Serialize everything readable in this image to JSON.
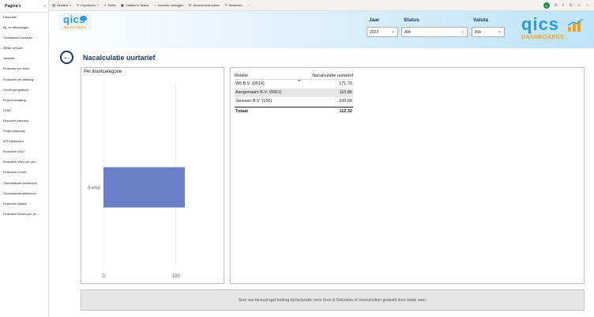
{
  "sidebar": {
    "title": "Pagina's",
    "collapse_icon": "«",
    "items": [
      {
        "label": "Facturatie"
      },
      {
        "label": "Bij- en afboekingen"
      },
      {
        "label": "Gerealiseerd uurtarief"
      },
      {
        "label": "Ziekte verzuim"
      },
      {
        "label": "Vakantie"
      },
      {
        "label": "Producten per klant"
      },
      {
        "label": "Producten per afdeling"
      },
      {
        "label": "Omzet geografisch"
      },
      {
        "label": "Projectvoortgang"
      },
      {
        "label": "OHW"
      },
      {
        "label": "Resource planning"
      },
      {
        "label": "Project planning"
      },
      {
        "label": "KPI Dashboard"
      },
      {
        "label": "Financieel W&V"
      },
      {
        "label": "Financieel W&V per per..."
      },
      {
        "label": "Financieel Omzet"
      },
      {
        "label": "Openstaande crediteuren"
      },
      {
        "label": "Openstaande debiteuren"
      },
      {
        "label": "Financieel Balans"
      },
      {
        "label": "Financieel Balans per pe..."
      }
    ]
  },
  "toolbar": {
    "items": [
      {
        "icon": "document-icon",
        "glyph": "▤",
        "label": "Bestand",
        "chevron": "˅"
      },
      {
        "icon": "export-icon",
        "glyph": "⇥",
        "label": "Exporteren",
        "chevron": "˅"
      },
      {
        "icon": "share-icon",
        "glyph": "↗",
        "label": "Delen",
        "chevron": ""
      },
      {
        "icon": "teams-icon",
        "glyph": "▣",
        "label": "Chatten in Teams",
        "chevron": ""
      },
      {
        "icon": "lightbulb-icon",
        "glyph": "♁",
        "label": "Inzichten verkrijgen",
        "chevron": ""
      },
      {
        "icon": "mail-icon",
        "glyph": "✉",
        "label": "Abonnement maken",
        "chevron": ""
      },
      {
        "icon": "pencil-icon",
        "glyph": "✎",
        "label": "Bewerken",
        "chevron": ""
      },
      {
        "icon": "more-icon",
        "glyph": "···",
        "label": "",
        "chevron": ""
      }
    ],
    "right": {
      "avatar_initial": "G",
      "bookmark_glyph": "⊓",
      "chevron": "˅",
      "refresh_glyph": "↻",
      "comment_glyph": "▭",
      "favorite_glyph": "☆"
    }
  },
  "banner": {
    "logo_left": {
      "text": "qics",
      "subtext": "MILESTONES"
    },
    "logo_right": {
      "text": "qics",
      "subtext": "DASHBOARDS"
    },
    "filters": {
      "jaar": {
        "label": "Jaar",
        "value": "2022"
      },
      "status": {
        "label": "Status",
        "value": "Alle"
      },
      "valuta": {
        "label": "Valuta",
        "value": "Alle"
      }
    },
    "chevron": "⌄"
  },
  "page": {
    "title": "Nacalculatie uurtarief",
    "back_glyph": "←"
  },
  "chart_data": {
    "type": "bar",
    "orientation": "horizontal",
    "title": "Per klantcategorie",
    "categories": [
      "(Leeg)"
    ],
    "values": [
      112.32
    ],
    "xlim": [
      0,
      120
    ],
    "xticks": [
      0,
      100
    ],
    "color": "#6b7fc7",
    "grid": true
  },
  "table": {
    "columns": [
      "Relatie",
      "Nacalculatie uurtarief"
    ],
    "sort_glyph": "▼",
    "rows": [
      {
        "relatie": "Wit B.V. (0014)",
        "value": "171,70",
        "highlight": false
      },
      {
        "relatie": "Aangenaam B.V. (0001)",
        "value": "110,86",
        "highlight": true
      },
      {
        "relatie": "Janssen B.V. (100)",
        "value": "100,00",
        "highlight": false
      }
    ],
    "total": {
      "label": "Totaal",
      "value": "112,32"
    }
  },
  "note": {
    "text": "Som van factuurregel bedrag bij facturatie vorm Uren & Onkosten of Voorschotten gedeeld door totale uren."
  },
  "colors": {
    "title": "#1f3864",
    "bar": "#6b7fc7",
    "logo_blue": "#2d9ad6",
    "logo_orange": "#f2a21b"
  }
}
